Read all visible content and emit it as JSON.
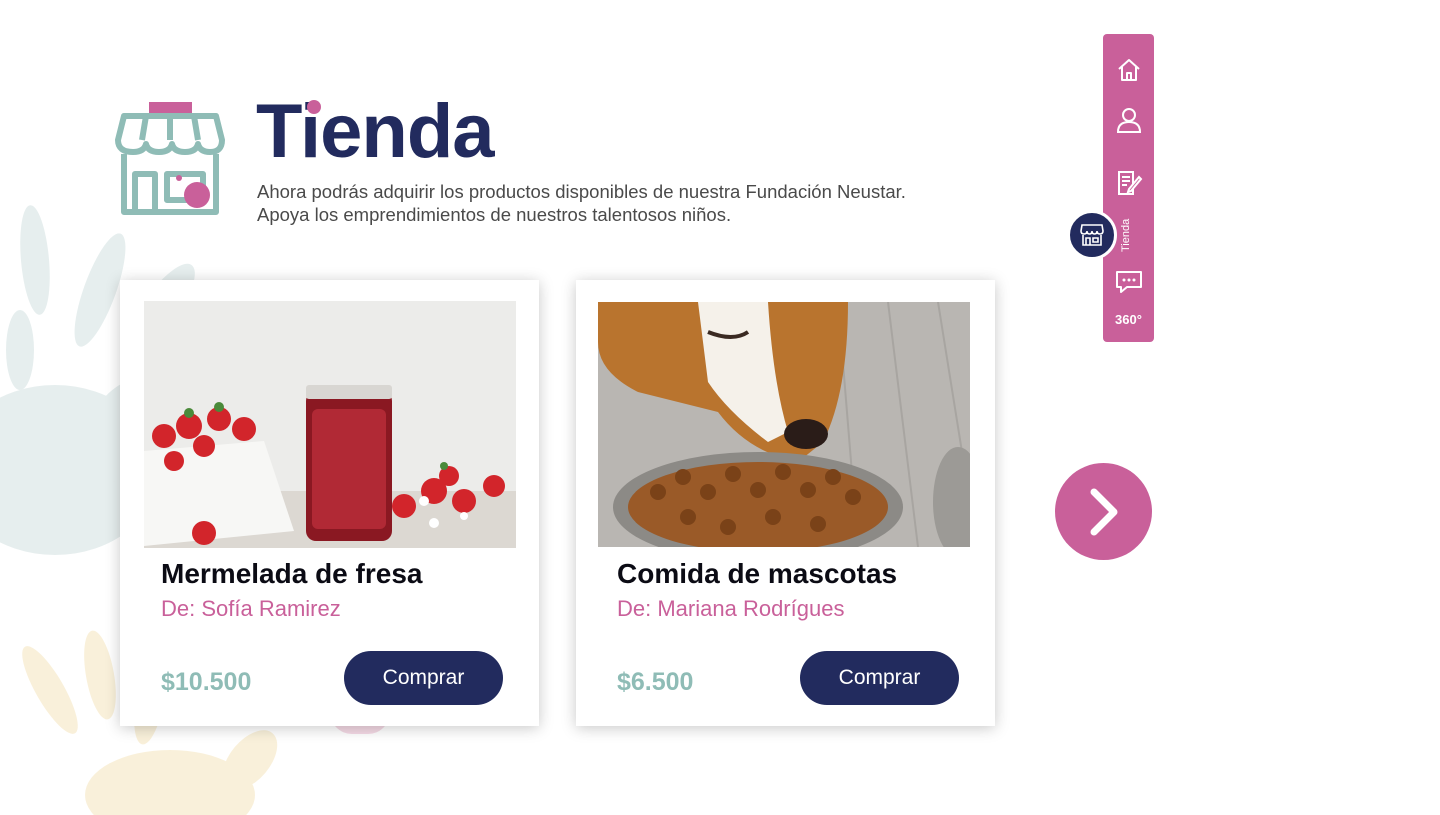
{
  "header": {
    "title": "Tienda",
    "subtitle": "Ahora podrás adquirir los productos disponibles de nuestra Fundación Neustar. Apoya los emprendimientos de nuestros talentosos niños."
  },
  "products": [
    {
      "name": "Mermelada de fresa",
      "author": "De: Sofía Ramirez",
      "price": "$10.500",
      "button_label": "Comprar"
    },
    {
      "name": "Comida de mascotas",
      "author": "De: Mariana Rodrígues",
      "price": "$6.500",
      "button_label": "Comprar"
    }
  ],
  "side_nav": {
    "items": [
      "home-icon",
      "user-icon",
      "edit-icon",
      "store-icon",
      "chat-icon"
    ],
    "active_label": "Tienda",
    "label_360": "360°"
  },
  "icons": {
    "logo": "store-icon",
    "next": "chevron-right-icon"
  },
  "colors": {
    "navy": "#222b5e",
    "pink": "#c9609a",
    "teal": "#8fbcb6"
  }
}
